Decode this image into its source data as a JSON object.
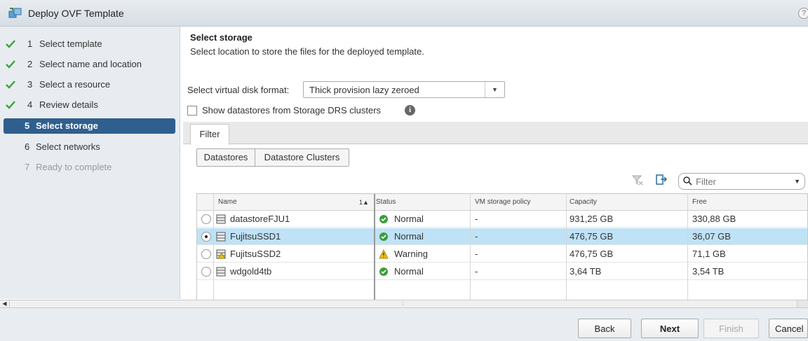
{
  "window": {
    "title": "Deploy OVF Template",
    "help": "?"
  },
  "wizard": {
    "steps": [
      {
        "num": "1",
        "label": "Select template",
        "state": "done"
      },
      {
        "num": "2",
        "label": "Select name and location",
        "state": "done"
      },
      {
        "num": "3",
        "label": "Select a resource",
        "state": "done"
      },
      {
        "num": "4",
        "label": "Review details",
        "state": "done"
      },
      {
        "num": "5",
        "label": "Select storage",
        "state": "active"
      },
      {
        "num": "6",
        "label": "Select networks",
        "state": "pending"
      },
      {
        "num": "7",
        "label": "Ready to complete",
        "state": "disabled"
      }
    ]
  },
  "page": {
    "title": "Select storage",
    "subtitle": "Select location to store the files for the deployed template."
  },
  "disk_format": {
    "label": "Select virtual disk format:",
    "value": "Thick provision lazy zeroed"
  },
  "sdrs": {
    "label": "Show datastores from Storage DRS clusters",
    "checked": false
  },
  "tabs": {
    "filter": "Filter"
  },
  "segments": {
    "datastores": "Datastores",
    "clusters": "Datastore Clusters"
  },
  "filter": {
    "placeholder": "Filter"
  },
  "grid": {
    "headers": {
      "name": "Name",
      "sort": "1▲",
      "status": "Status",
      "policy": "VM storage policy",
      "capacity": "Capacity",
      "free": "Free"
    },
    "rows": [
      {
        "name": "datastoreFJU1",
        "status": "Normal",
        "status_kind": "ok",
        "policy": "-",
        "capacity": "931,25  GB",
        "free": "330,88  GB",
        "selected": false,
        "warn_icon": false
      },
      {
        "name": "FujitsuSSD1",
        "status": "Normal",
        "status_kind": "ok",
        "policy": "-",
        "capacity": "476,75  GB",
        "free": "36,07  GB",
        "selected": true,
        "warn_icon": false
      },
      {
        "name": "FujitsuSSD2",
        "status": "Warning",
        "status_kind": "warn",
        "policy": "-",
        "capacity": "476,75  GB",
        "free": "71,1  GB",
        "selected": false,
        "warn_icon": true
      },
      {
        "name": "wdgold4tb",
        "status": "Normal",
        "status_kind": "ok",
        "policy": "-",
        "capacity": "3,64  TB",
        "free": "3,54  TB",
        "selected": false,
        "warn_icon": false
      }
    ]
  },
  "scrollbar": {
    "grip": "::"
  },
  "buttons": {
    "back": "Back",
    "next": "Next",
    "finish": "Finish",
    "cancel": "Cancel"
  },
  "colors": {
    "active_step": "#2f5f8f",
    "selected_row": "#bfe2f6",
    "ok": "#3a9d3a",
    "warn": "#f2c200"
  }
}
